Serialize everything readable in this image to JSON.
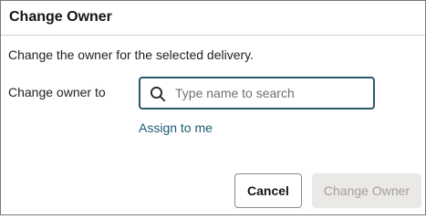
{
  "dialog": {
    "title": "Change Owner",
    "description": "Change the owner for the selected delivery.",
    "owner_field": {
      "label": "Change owner to",
      "value": "",
      "placeholder": "Type name to search",
      "icon": "search-icon"
    },
    "assign_link": "Assign to me",
    "buttons": {
      "cancel": "Cancel",
      "submit": "Change Owner",
      "submit_disabled": true
    }
  },
  "colors": {
    "field_border": "#2c5967",
    "link": "#1d5c73",
    "disabled_button_bg": "#ebe9e6",
    "disabled_button_text": "#a3a09c"
  }
}
